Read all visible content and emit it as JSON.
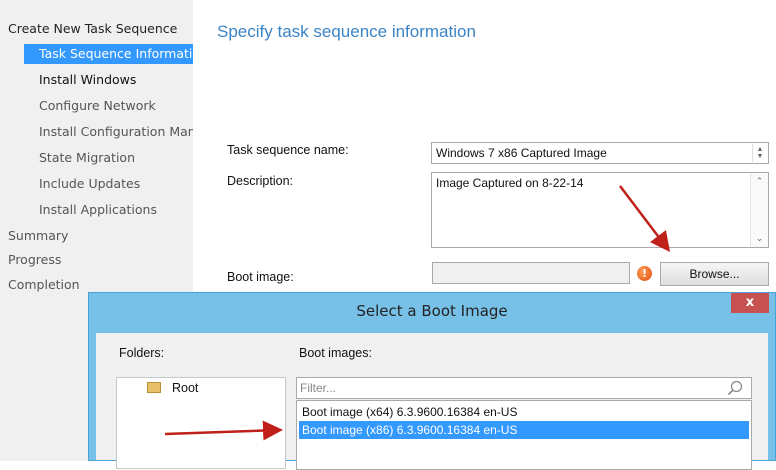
{
  "nav": {
    "items": [
      {
        "label": "Create New Task Sequence"
      },
      {
        "label": "Task Sequence Information"
      },
      {
        "label": "Install Windows"
      },
      {
        "label": "Configure Network"
      },
      {
        "label": "Install Configuration Manager"
      },
      {
        "label": "State Migration"
      },
      {
        "label": "Include Updates"
      },
      {
        "label": "Install Applications"
      },
      {
        "label": "Summary"
      },
      {
        "label": "Progress"
      },
      {
        "label": "Completion"
      }
    ]
  },
  "page": {
    "heading": "Specify task sequence information",
    "name_label": "Task sequence name:",
    "name_value": "Windows 7 x86 Captured Image",
    "description_label": "Description:",
    "description_value": "Image Captured on 8-22-14",
    "boot_image_label": "Boot image:",
    "boot_image_value": "",
    "browse_label": "Browse...",
    "warning_glyph": "!"
  },
  "dialog": {
    "title": "Select a Boot Image",
    "close_glyph": "x",
    "folders_label": "Folders:",
    "boot_images_label": "Boot images:",
    "tree_root": "Root",
    "filter_placeholder": "Filter...",
    "items": [
      {
        "label": "Boot image (x64) 6.3.9600.16384 en-US",
        "selected": false
      },
      {
        "label": "Boot image (x86) 6.3.9600.16384 en-US",
        "selected": true
      }
    ]
  },
  "colors": {
    "accent": "#3399ff",
    "heading": "#3b84c5",
    "arrow": "#c0201a",
    "dialog_frame": "#77c1e8",
    "close": "#c75050"
  }
}
